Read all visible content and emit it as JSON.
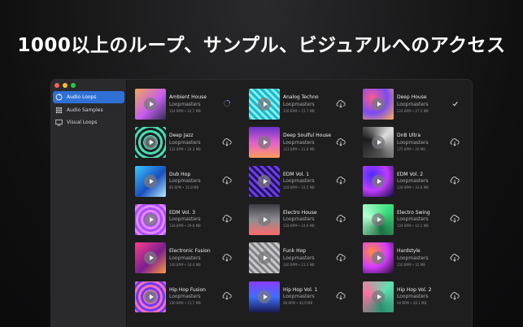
{
  "headline": "1000以上のループ、サンプル、ビジュアルへのアクセス",
  "sidebar": {
    "items": [
      {
        "label": "Audio Loops",
        "icon": "loop-icon",
        "active": true
      },
      {
        "label": "Audio Samples",
        "icon": "grid-icon",
        "active": false
      },
      {
        "label": "Visual Loops",
        "icon": "monitor-icon",
        "active": false
      }
    ]
  },
  "packs": [
    {
      "name": "Ambient House",
      "author": "Loopmasters",
      "info": "124 BPM • 24.7 MB",
      "status": "downloading",
      "colors": [
        "#f2a65a",
        "#c65cf0",
        "#2f2f50"
      ]
    },
    {
      "name": "Analog Techno",
      "author": "Loopmasters",
      "info": "126 BPM • 15.7 MB",
      "status": "download",
      "colors": [
        "#18b9d6",
        "#1d2f66",
        "#8af0e0"
      ]
    },
    {
      "name": "Deep House",
      "author": "Loopmasters",
      "info": "124 BPM • 27.5 MB",
      "status": "downloaded",
      "colors": [
        "#ff5a8a",
        "#7a4cf5",
        "#ffb14a"
      ]
    },
    {
      "name": "Deep Jazz",
      "author": "Loopmasters",
      "info": "122 BPM • 24.3 MB",
      "status": "download",
      "colors": [
        "#46e0a8",
        "#ff4fb5",
        "#1f1f2e"
      ]
    },
    {
      "name": "Deep Soulful House",
      "author": "Loopmasters",
      "info": "123 BPM • 21.8 MB",
      "status": "download",
      "colors": [
        "#e25fd1",
        "#6a34c7",
        "#ff9b5a"
      ]
    },
    {
      "name": "DnB Ultra",
      "author": "Loopmasters",
      "info": "175 BPM • 26 MB",
      "status": "download",
      "colors": [
        "#dddddd",
        "#555555",
        "#1c1c1c"
      ]
    },
    {
      "name": "Dub Hop",
      "author": "Loopmasters",
      "info": "85 BPM • 15.8 MB",
      "status": "download",
      "colors": [
        "#39c7ff",
        "#1a4fbf",
        "#b6ecff"
      ]
    },
    {
      "name": "EDM Vol. 1",
      "author": "Loopmasters",
      "info": "128 BPM • 33.5 MB",
      "status": "download",
      "colors": [
        "#6b3cf0",
        "#ff3fd2",
        "#20134a"
      ]
    },
    {
      "name": "EDM Vol. 2",
      "author": "Loopmasters",
      "info": "128 BPM • 33.6 MB",
      "status": "download",
      "colors": [
        "#4c2cff",
        "#c03cff",
        "#0e0a3a"
      ]
    },
    {
      "name": "EDM Vol. 3",
      "author": "Loopmasters",
      "info": "128 BPM • 29.8 MB",
      "status": "download",
      "colors": [
        "#b04cff",
        "#2b1070",
        "#e08aff"
      ]
    },
    {
      "name": "Electro House",
      "author": "Loopmasters",
      "info": "128 BPM • 24.9 MB",
      "status": "download",
      "colors": [
        "#8e8e94",
        "#3a3a40",
        "#ff6a6a"
      ]
    },
    {
      "name": "Electro Swing",
      "author": "Loopmasters",
      "info": "124 BPM • 10.1 MB",
      "status": "download",
      "colors": [
        "#3ae07e",
        "#1e6f43",
        "#b4ffd1"
      ]
    },
    {
      "name": "Electronic Fusion",
      "author": "Loopmasters",
      "info": "140 BPM • 16.4 MB",
      "status": "download",
      "colors": [
        "#ff3c8e",
        "#7a1f8f",
        "#ff9a3c"
      ]
    },
    {
      "name": "Funk Hop",
      "author": "Loopmasters",
      "info": "100 BPM • 23.3 MB",
      "status": "download",
      "colors": [
        "#c7c7c7",
        "#f0f0f0",
        "#7f7f85"
      ]
    },
    {
      "name": "Hardstyle",
      "author": "Loopmasters",
      "info": "150 BPM • 32 MB",
      "status": "download",
      "colors": [
        "#ff8a3c",
        "#d63cff",
        "#1f0f2f"
      ]
    },
    {
      "name": "Hip Hop Fusion",
      "author": "Loopmasters",
      "info": "100 BPM • 15.7 MB",
      "status": "download",
      "colors": [
        "#ff6fb0",
        "#f0c040",
        "#6a3cff"
      ]
    },
    {
      "name": "Hip Hop Vol. 1",
      "author": "Loopmasters",
      "info": "98 BPM • 44.9 MB",
      "status": "download",
      "colors": [
        "#3c6fff",
        "#8a3cff",
        "#1a1a50"
      ]
    },
    {
      "name": "Hip Hop Vol. 2",
      "author": "Loopmasters",
      "info": "90 BPM • 28.1 MB",
      "status": "download",
      "colors": [
        "#5fe0b0",
        "#2a8f6f",
        "#ff6fa0"
      ]
    }
  ],
  "colors": {
    "accent": "#2f6fd6",
    "window": "#1e1e1f",
    "sidebar": "#2a2a2c"
  }
}
